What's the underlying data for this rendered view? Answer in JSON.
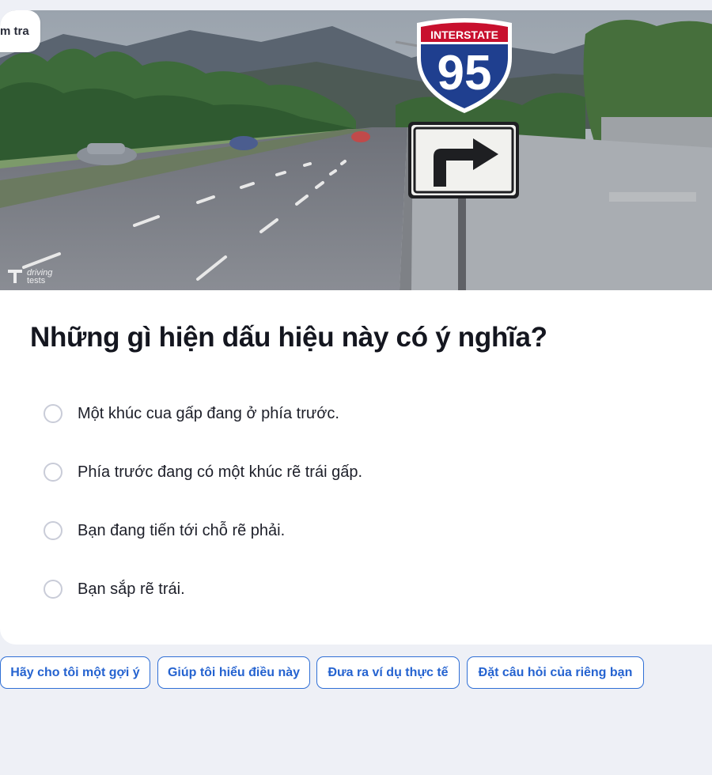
{
  "tag": {
    "label": "m tra"
  },
  "hero": {
    "sign_top_text": "INTERSTATE",
    "sign_number": "95",
    "watermark_line1": "driving",
    "watermark_line2": "tests"
  },
  "question": {
    "text": "Những gì hiện dấu hiệu này có ý nghĩa?",
    "options": [
      {
        "label": "Một khúc cua gấp đang ở phía trước."
      },
      {
        "label": "Phía trước đang có một khúc rẽ trái gấp."
      },
      {
        "label": "Bạn đang tiến tới chỗ rẽ phải."
      },
      {
        "label": "Bạn sắp rẽ trái."
      }
    ]
  },
  "chips": [
    {
      "label": "Hãy cho tôi một gợi ý"
    },
    {
      "label": "Giúp tôi hiểu điều này"
    },
    {
      "label": "Đưa ra ví dụ thực tế"
    },
    {
      "label": "Đặt câu hỏi của riêng bạn"
    }
  ],
  "colors": {
    "accent": "#2563d0",
    "background": "#eef0f6",
    "card": "#ffffff",
    "sign_red": "#c8102e",
    "sign_blue": "#1f3f8f"
  }
}
